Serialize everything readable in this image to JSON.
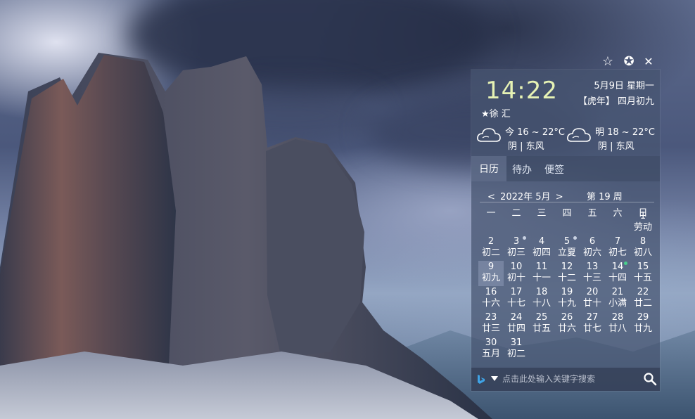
{
  "top_actions": {
    "star": "☆",
    "favorite": "✪",
    "close": "✕"
  },
  "widget": {
    "time": "14:22",
    "date": "5月9日  星期一",
    "lunar": "【虎年】  四月初九",
    "location": "★徐 汇",
    "weather_today": {
      "temp": "今 16 ~ 22°C",
      "cond": "阴 | 东风"
    },
    "weather_tomorrow": {
      "temp": "明 18 ~ 22°C",
      "cond": "阴 | 东风"
    },
    "tabs": [
      "日历",
      "待办",
      "便签"
    ],
    "calendar": {
      "prev": "<",
      "month_label": "2022年 5月",
      "next": ">",
      "week_label": "第 19 周",
      "weekdays": [
        "一",
        "二",
        "三",
        "四",
        "五",
        "六",
        "日"
      ],
      "days": [
        {
          "n": "1",
          "l": "劳动"
        },
        {
          "n": "2",
          "l": "初二"
        },
        {
          "n": "3",
          "l": "初三"
        },
        {
          "n": "4",
          "l": "初四"
        },
        {
          "n": "5",
          "l": "立夏"
        },
        {
          "n": "6",
          "l": "初六"
        },
        {
          "n": "7",
          "l": "初七"
        },
        {
          "n": "8",
          "l": "初八"
        },
        {
          "n": "9",
          "l": "初九"
        },
        {
          "n": "10",
          "l": "初十"
        },
        {
          "n": "11",
          "l": "十一"
        },
        {
          "n": "12",
          "l": "十二"
        },
        {
          "n": "13",
          "l": "十三"
        },
        {
          "n": "14",
          "l": "十四"
        },
        {
          "n": "15",
          "l": "十五"
        },
        {
          "n": "16",
          "l": "十六"
        },
        {
          "n": "17",
          "l": "十七"
        },
        {
          "n": "18",
          "l": "十八"
        },
        {
          "n": "19",
          "l": "十九"
        },
        {
          "n": "20",
          "l": "廿十"
        },
        {
          "n": "21",
          "l": "小满"
        },
        {
          "n": "22",
          "l": "廿二"
        },
        {
          "n": "23",
          "l": "廿三"
        },
        {
          "n": "24",
          "l": "廿四"
        },
        {
          "n": "25",
          "l": "廿五"
        },
        {
          "n": "26",
          "l": "廿六"
        },
        {
          "n": "27",
          "l": "廿七"
        },
        {
          "n": "28",
          "l": "廿八"
        },
        {
          "n": "29",
          "l": "廿九"
        },
        {
          "n": "30",
          "l": "五月"
        },
        {
          "n": "31",
          "l": "初二"
        }
      ],
      "today": "9",
      "marker_colors": {
        "3": "#c9d2e2",
        "5": "#c9d2e2",
        "14": "#48d08c"
      }
    },
    "search": {
      "placeholder": "点击此处输入关键字搜索",
      "engine_icon": "bing-icon",
      "dropdown_icon": "triangle-down-icon",
      "search_icon": "magnifier-icon"
    }
  }
}
